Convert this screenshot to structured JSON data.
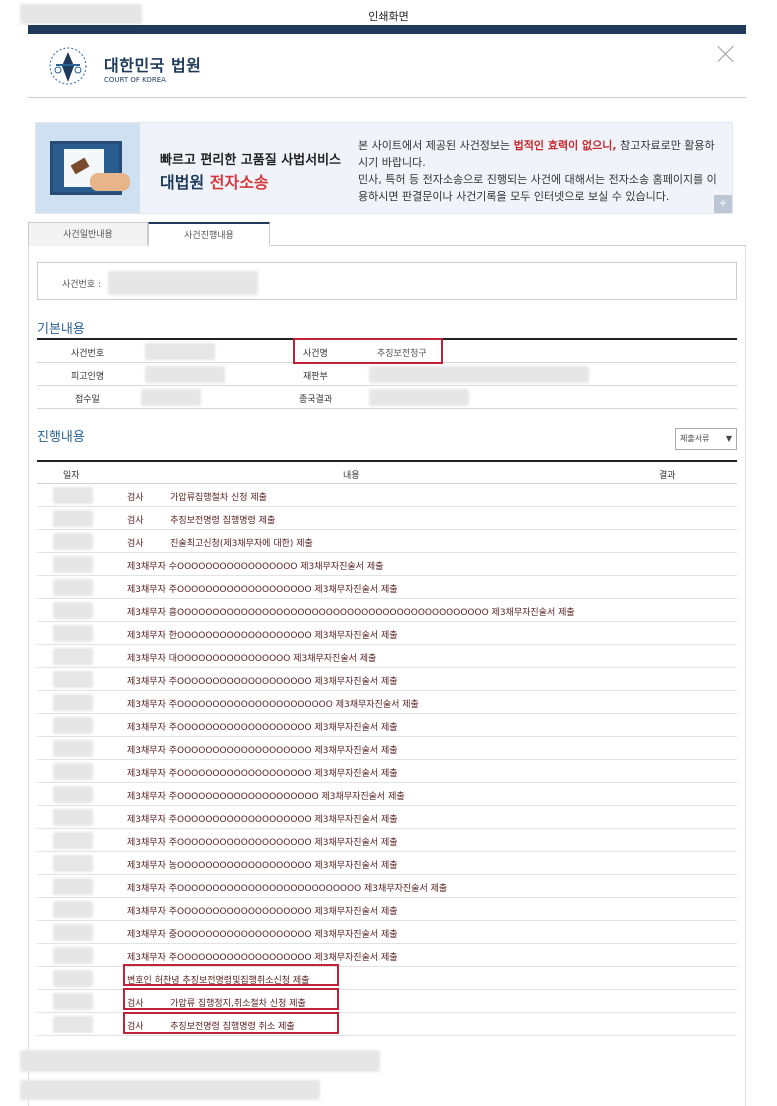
{
  "window": {
    "title": "인쇄화면"
  },
  "logo": {
    "title": "대한민국 법원",
    "subtitle": "COURT OF KOREA"
  },
  "banner": {
    "headline": "빠르고 편리한 고품질 사법서비스",
    "brand_prefix": "대법원",
    "brand_highlight": "전자소송",
    "notice_1": "본 사이트에서 제공된 사건정보는",
    "notice_bold": "법적인 효력이 없으니,",
    "notice_2": "참고자료로만 활용하시기 바랍니다.",
    "notice_3": "민사, 특허 등 전자소송으로 진행되는 사건에 대해서는 전자소송 홈페이지를 이용하시면 판결문이나 사건기록을 모두 인터넷으로 보실 수 있습니다.",
    "plus": "+"
  },
  "tabs": [
    {
      "label": "사건일반내용"
    },
    {
      "label": "사건진행내용"
    }
  ],
  "casebox": {
    "label": "사건번호 :"
  },
  "basic": {
    "title": "기본내용",
    "case_no_label": "사건번호",
    "case_name_label": "사건명",
    "case_name_value": "추징보전청구",
    "defendant_label": "피고인명",
    "court_label": "재판부",
    "received_label": "접수일",
    "result_label": "종국결과"
  },
  "progress": {
    "title": "진행내용",
    "select_value": "제출서류",
    "col_date": "일자",
    "col_content": "내용",
    "col_result": "결과",
    "rows": [
      "검사 　 　 가압류집행절차 신청 제출",
      "검사 　 　 추징보전명령 집행명령 제출",
      "검사 　 　 진술최고신청(제3채무자에 대한) 제출",
      "제3채무자 수OOOOOOOOOOOOOOOOO 제3채무자진술서 제출",
      "제3채무자 주OOOOOOOOOOOOOOOOOOO 제3채무자진술서 제출",
      "제3채무자 흥OOOOOOOOOOOOOOOOOOOOOOOOOOOOOOOOOOOOOOOOOOOO 제3채무자진술서 제출",
      "제3채무자 한OOOOOOOOOOOOOOOOOOO 제3채무자진술서 제출",
      "제3채무자 대OOOOOOOOOOOOOOOO 제3채무자진술서 제출",
      "제3채무자 주OOOOOOOOOOOOOOOOOOO 제3채무자진술서 제출",
      "제3채무자 주OOOOOOOOOOOOOOOOOOOOOO 제3채무자진술서 제출",
      "제3채무자 주OOOOOOOOOOOOOOOOOOO 제3채무자진술서 제출",
      "제3채무자 주OOOOOOOOOOOOOOOOOOO 제3채무자진술서 제출",
      "제3채무자 주OOOOOOOOOOOOOOOOOOO 제3채무자진술서 제출",
      "제3채무자 주OOOOOOOOOOOOOOOOOOOO 제3채무자진술서 제출",
      "제3채무자 주OOOOOOOOOOOOOOOOOOO 제3채무자진술서 제출",
      "제3채무자 주OOOOOOOOOOOOOOOOOOO 제3채무자진술서 제출",
      "제3채무자 농OOOOOOOOOOOOOOOOOOO 제3채무자진술서 제출",
      "제3채무자 주OOOOOOOOOOOOOOOOOOOOOOOOOO 제3채무자진술서 제출",
      "제3채무자 주OOOOOOOOOOOOOOOOOOO 제3채무자진술서 제출",
      "제3채무자 중OOOOOOOOOOOOOOOOOOO 제3채무자진술서 제출",
      "제3채무자 주OOOOOOOOOOOOOOOOOOO 제3채무자진술서 제출",
      "변호인 허찬녕 추징보전명령및집행취소신청 제출",
      "검사 　 　 가압류 집행정지,취소절차 신청 제출",
      "검사 　 　 추징보전명령 집행명령 취소 제출"
    ]
  },
  "colors": {
    "navy": "#1f3b5c",
    "highlight_red": "#c0223a",
    "row_text": "#5b2222"
  }
}
